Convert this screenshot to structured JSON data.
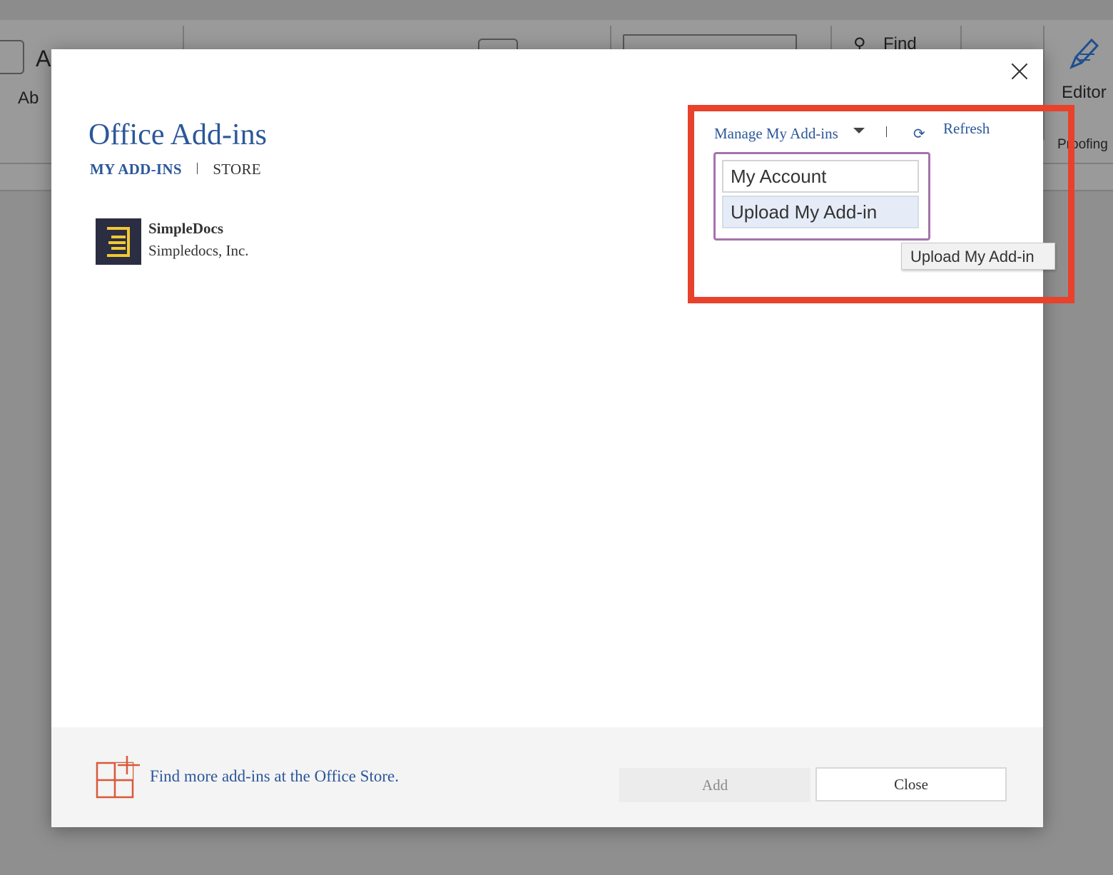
{
  "ribbon": {
    "font_sample": "A",
    "style_sample": "Ab",
    "find_label": "Find",
    "editor_label": "Editor",
    "proofing_label": "Proofing"
  },
  "dialog": {
    "title": "Office Add-ins",
    "tabs": [
      {
        "label": "MY ADD-INS",
        "active": true
      },
      {
        "label": "STORE",
        "active": false
      }
    ],
    "addins": [
      {
        "name": "SimpleDocs",
        "publisher": "Simpledocs, Inc."
      }
    ],
    "manage": {
      "label": "Manage My Add-ins",
      "refresh_label": "Refresh",
      "menu_items": [
        "My Account",
        "Upload My Add-in"
      ],
      "tooltip": "Upload My Add-in"
    },
    "footer": {
      "store_link": "Find more add-ins at the Office Store.",
      "add_label": "Add",
      "close_label": "Close"
    }
  },
  "colors": {
    "accent": "#2b579a",
    "highlight": "#e8412c",
    "dropdown_border": "#a573ad",
    "store_icon": "#d9593a"
  }
}
